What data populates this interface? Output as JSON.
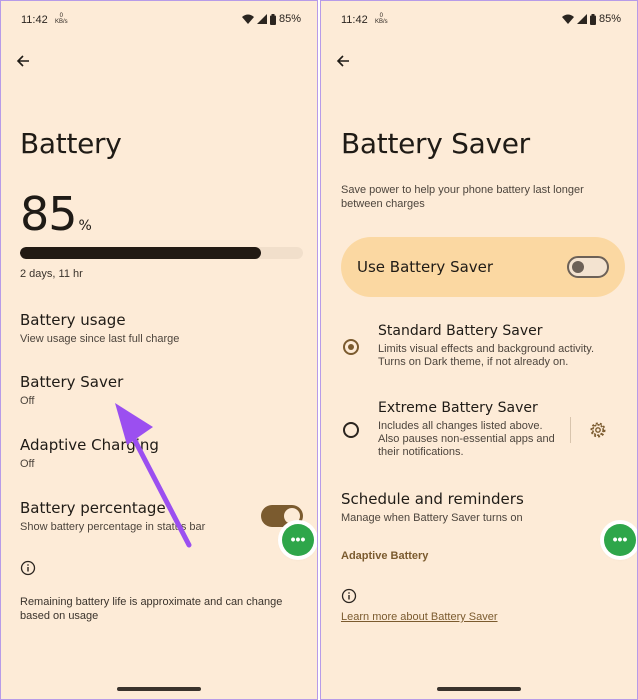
{
  "left": {
    "status": {
      "time": "11:42",
      "kbs_value": "0",
      "kbs_unit": "KB/s",
      "battery": "85%"
    },
    "title": "Battery",
    "level": {
      "value": "85",
      "unit": "%",
      "fraction": 0.85
    },
    "remaining": "2 days, 11 hr",
    "items": [
      {
        "title": "Battery usage",
        "subtitle": "View usage since last full charge"
      },
      {
        "title": "Battery Saver",
        "subtitle": "Off"
      },
      {
        "title": "Adaptive Charging",
        "subtitle": "Off"
      },
      {
        "title": "Battery percentage",
        "subtitle": "Show battery percentage in status bar"
      }
    ],
    "note": "Remaining battery life is approximate and can change based on usage",
    "fab_label": "•••"
  },
  "right": {
    "status": {
      "time": "11:42",
      "kbs_value": "0",
      "kbs_unit": "KB/s",
      "battery": "85%"
    },
    "title": "Battery Saver",
    "description": "Save power to help your phone battery last longer between charges",
    "use_saver_label": "Use Battery Saver",
    "options": [
      {
        "title": "Standard Battery Saver",
        "line1": "Limits visual effects and background activity.",
        "line2": "Turns on Dark theme, if not already on."
      },
      {
        "title": "Extreme Battery Saver",
        "line1": "Includes all changes listed above.",
        "line2": "Also pauses non-essential apps and",
        "line3": "their notifications."
      }
    ],
    "schedule": {
      "title": "Schedule and reminders",
      "subtitle": "Manage when Battery Saver turns on"
    },
    "adaptive_battery": "Adaptive Battery",
    "learn_more": "Learn more about Battery Saver",
    "fab_label": "•••"
  },
  "colors": {
    "accent": "#7b5b2f",
    "background": "#fdebd7",
    "card": "#fbd8a2",
    "fab": "#2ea64a",
    "arrow": "#9b4ff0"
  },
  "icons": [
    "back-arrow-icon",
    "wifi-icon",
    "signal-icon",
    "battery-icon",
    "info-icon",
    "gear-icon",
    "more-icon"
  ]
}
